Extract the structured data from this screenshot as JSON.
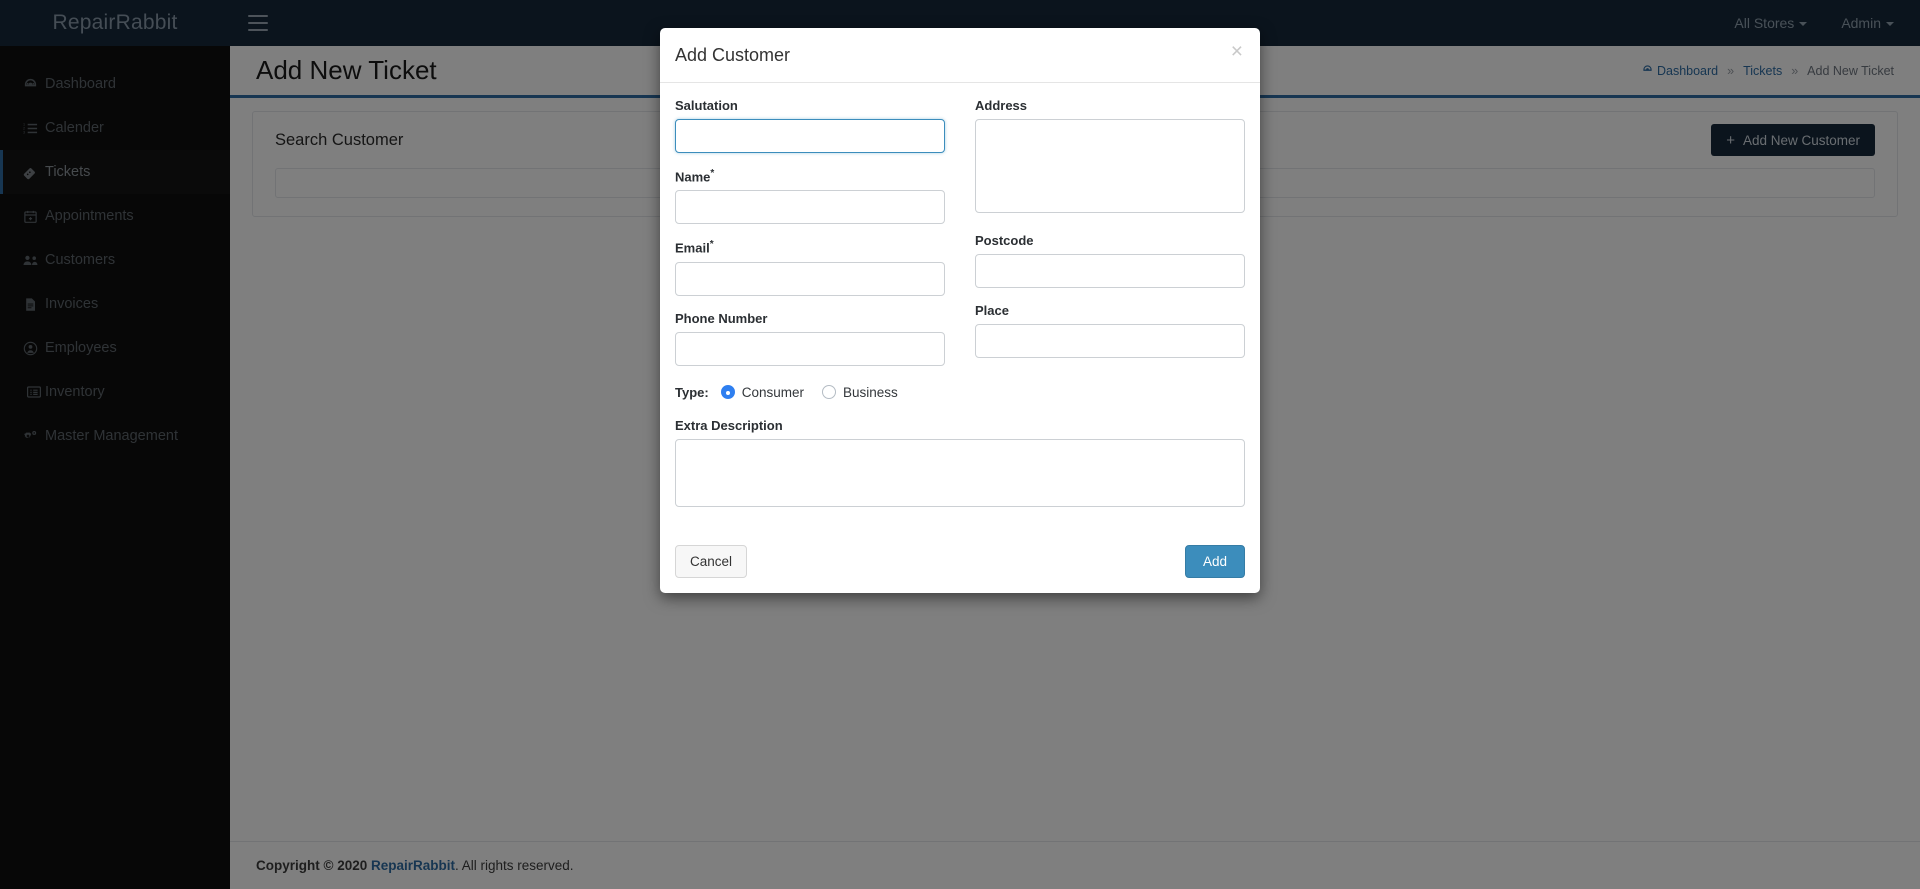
{
  "sidebar": {
    "brand": "RepairRabbit",
    "items": [
      {
        "label": "Dashboard",
        "icon": "dashboard-icon",
        "active": false
      },
      {
        "label": "Calender",
        "icon": "calendar-list-icon",
        "active": false
      },
      {
        "label": "Tickets",
        "icon": "ticket-icon",
        "active": true
      },
      {
        "label": "Appointments",
        "icon": "calendar-plus-icon",
        "active": false
      },
      {
        "label": "Customers",
        "icon": "users-icon",
        "active": false
      },
      {
        "label": "Invoices",
        "icon": "file-invoice-icon",
        "active": false
      },
      {
        "label": "Employees",
        "icon": "user-circle-icon",
        "active": false
      },
      {
        "label": "Inventory",
        "icon": "list-box-icon",
        "active": false
      },
      {
        "label": "Master Management",
        "icon": "cogs-icon",
        "active": false
      }
    ]
  },
  "topbar": {
    "menu_toggle": "hamburger-icon",
    "stores_label": "All Stores",
    "user_label": "Admin"
  },
  "page": {
    "title": "Add New Ticket",
    "breadcrumb": {
      "home": "Dashboard",
      "sep1": "»",
      "middle": "Tickets",
      "sep2": "»",
      "current": "Add New Ticket"
    },
    "panel": {
      "title": "Search Customer",
      "add_customer_button": "Add New Customer",
      "add_icon": "+",
      "search_value": "",
      "search_placeholder": ""
    }
  },
  "footer": {
    "copyright_prefix": "Copyright © 2020",
    "brand": "RepairRabbit",
    "copyright_suffix": ". All rights reserved."
  },
  "modal": {
    "title": "Add Customer",
    "close_icon": "×",
    "fields": {
      "salutation": {
        "label": "Salutation",
        "value": "",
        "placeholder": "",
        "required": false,
        "focused": true
      },
      "name": {
        "label": "Name",
        "value": "",
        "placeholder": "",
        "required": true,
        "required_mark": "*"
      },
      "email": {
        "label": "Email",
        "value": "",
        "placeholder": "",
        "required": true,
        "required_mark": "*"
      },
      "phone": {
        "label": "Phone Number",
        "value": "",
        "placeholder": ""
      },
      "address": {
        "label": "Address",
        "value": "",
        "placeholder": ""
      },
      "postcode": {
        "label": "Postcode",
        "value": "",
        "placeholder": ""
      },
      "place": {
        "label": "Place",
        "value": "",
        "placeholder": ""
      },
      "extra_description": {
        "label": "Extra Description",
        "value": "",
        "placeholder": ""
      }
    },
    "type": {
      "label": "Type:",
      "options": [
        {
          "label": "Consumer",
          "selected": true
        },
        {
          "label": "Business",
          "selected": false
        }
      ]
    },
    "cancel_button": "Cancel",
    "submit_button": "Add"
  },
  "colors": {
    "sidebar_bg": "#0f0f0f",
    "topbar_bg": "#16293b",
    "accent": "#2e6da4",
    "primary_button": "#3c8dbc",
    "radio_selected": "#2f7ff0"
  }
}
